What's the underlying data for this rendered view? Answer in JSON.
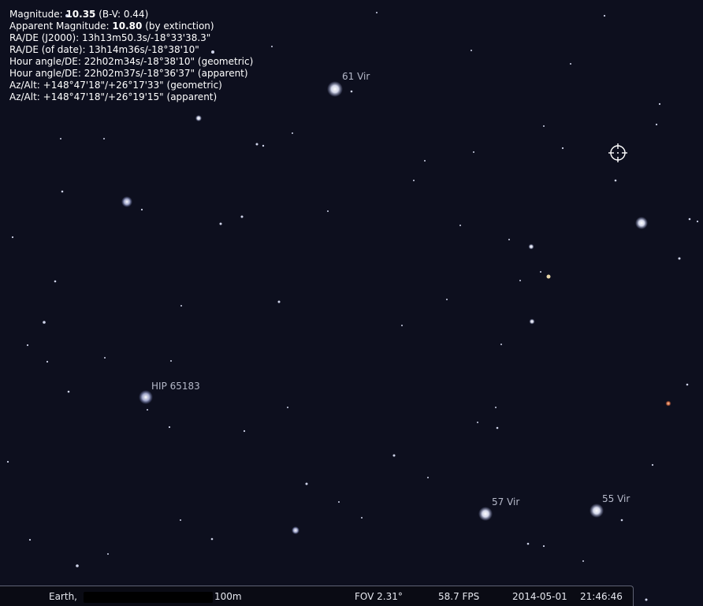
{
  "info": {
    "line1_prefix": "Magnitude: ",
    "line1_value": "10.35",
    "line1_suffix": " (B-V: 0.44)",
    "line2_prefix": "Apparent Magnitude: ",
    "line2_value": "10.80",
    "line2_suffix": " (by extinction)",
    "lines": [
      "RA/DE (J2000): 13h13m50.3s/-18°33'38.3\"",
      "RA/DE (of date): 13h14m36s/-18°38'10\"",
      "Hour angle/DE: 22h02m34s/-18°38'10\" (geometric)",
      "Hour angle/DE: 22h02m37s/-18°36'37\" (apparent)",
      "Az/Alt: +148°47'18\"/+26°17'33\" (geometric)",
      "Az/Alt: +148°47'18\"/+26°19'15\" (apparent)"
    ]
  },
  "labels": {
    "vir61": "61 Vir",
    "hip65183": "HIP 65183",
    "vir57": "57 Vir",
    "vir55": "55 Vir"
  },
  "status": {
    "location": "Earth,",
    "altitude": "100m",
    "fov": "FOV 2.31°",
    "fps": "58.7 FPS",
    "date": "2014-05-01",
    "time": "21:46:46"
  },
  "colors": {
    "sky": "#0d0f1e",
    "label": "#b5b9c9",
    "orange_star": "#ff9a66",
    "reticle": "#ffffff"
  }
}
